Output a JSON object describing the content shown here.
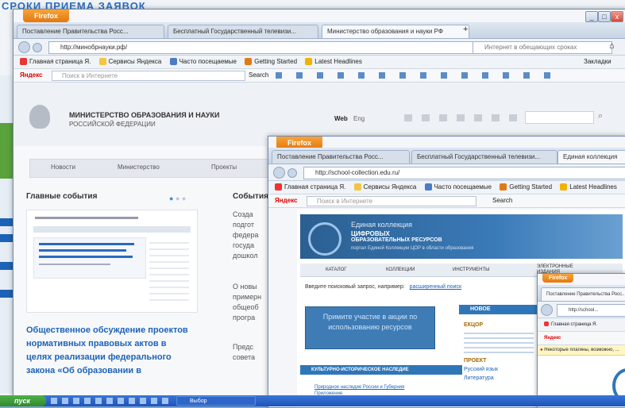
{
  "background": {
    "top_text": "СРОКИ ПРИЕМА ЗАЯВОК",
    "left_links": [
      "...",
      "...",
      "...",
      "..."
    ]
  },
  "colors": {
    "firefox_orange": "#e8801a",
    "ministry_blue": "#1c63b7",
    "header_dark": "#2b5f91"
  },
  "window1": {
    "firefox_button": "Firefox",
    "tabs": [
      "Поставление Правительства Росс...",
      "Бесплатный Государственный телевизи...",
      "Министерство образования и науки РФ"
    ],
    "url": "http://минобрнауки.рф/",
    "search_placeholder": "Интернет в обещающих сроках",
    "bookmarks": [
      "Главная страница Я.",
      "Сервисы Яндекса",
      "Часто посещаемые",
      "Getting Started",
      "Latest Headlines"
    ],
    "bookmarks_right": "Закладки",
    "yandex_label": "Яндекс",
    "yandex_search_placeholder": "Поиск в Интернете",
    "yandex_search_btn": "Search",
    "site": {
      "ministry_line1": "МИНИСТЕРСТВО ОБРАЗОВАНИЯ И НАУКИ",
      "ministry_line2": "РОССИЙСКОЙ ФЕДЕРАЦИИ",
      "header_right_label": "Web",
      "header_right_label2": "Eng",
      "nav": [
        "Новости",
        "Министерство",
        "Проекты"
      ],
      "main_events": "Главные события",
      "events_right": "События",
      "headline": "Общественное обсуждение проектов нормативных правовых актов в целях реализации федерального закона «Об образовании в",
      "right_snippets": [
        "Созда",
        "подгот",
        "федера",
        "госуда",
        "дошкол",
        "О новы",
        "примерн",
        "общеоб",
        "програ",
        "Предс",
        "совета"
      ]
    }
  },
  "window2": {
    "firefox_button": "Firefox",
    "tabs": [
      "Поставление Правительства Росс...",
      "Бесплатный Государственный телевизи...",
      "Единая коллекция"
    ],
    "url": "http://school-collection.edu.ru/",
    "bookmarks": [
      "Главная страница Я.",
      "Сервисы Яндекса",
      "Часто посещаемые",
      "Getting Started",
      "Latest Headlines"
    ],
    "yandex_label": "Яндекс",
    "yandex_search_placeholder": "Поиск в Интернете",
    "yandex_search_btn": "Search",
    "site": {
      "banner_line1": "Единая коллекция",
      "banner_line2": "ЦИФРОВЫХ",
      "banner_line3": "ОБРАЗОВАТЕЛЬНЫХ РЕСУРСОВ",
      "banner_sub": "портал Единой Коллекции ЦОР в области образования",
      "nav": [
        "КАТАЛОГ",
        "КОЛЛЕКЦИИ",
        "ИНСТРУМЕНТЫ",
        "ЭЛЕКТРОННЫЕ ИЗДАНИЯ"
      ],
      "search_hint": "Введите поисковый запрос, например:",
      "search_hint_link": "расширенный поиск",
      "cta": "Примите участие в акции по использованию ресурсов",
      "section_title": "КУЛЬТУРНО-ИСТОРИЧЕСКОЕ НАСЛЕДИЕ",
      "section_link": "Природное наследие России и Губерния Приложение",
      "side_title": "НОВОЕ",
      "side_items": [
        "ЕКЦОР",
        "ПРОЕКТ",
        "Русский язык",
        "Литература"
      ]
    }
  },
  "window3": {
    "firefox_button": "Firefox",
    "tab": "Поставление Правительства Росс...",
    "url": "http://school...",
    "bookmarks": [
      "Главная страница Я."
    ],
    "yandex_label": "Яндекс",
    "warning": "Некоторые плагины, возможно, ..."
  },
  "taskbar": {
    "start": "пуск",
    "items": [
      "Выбор"
    ]
  }
}
